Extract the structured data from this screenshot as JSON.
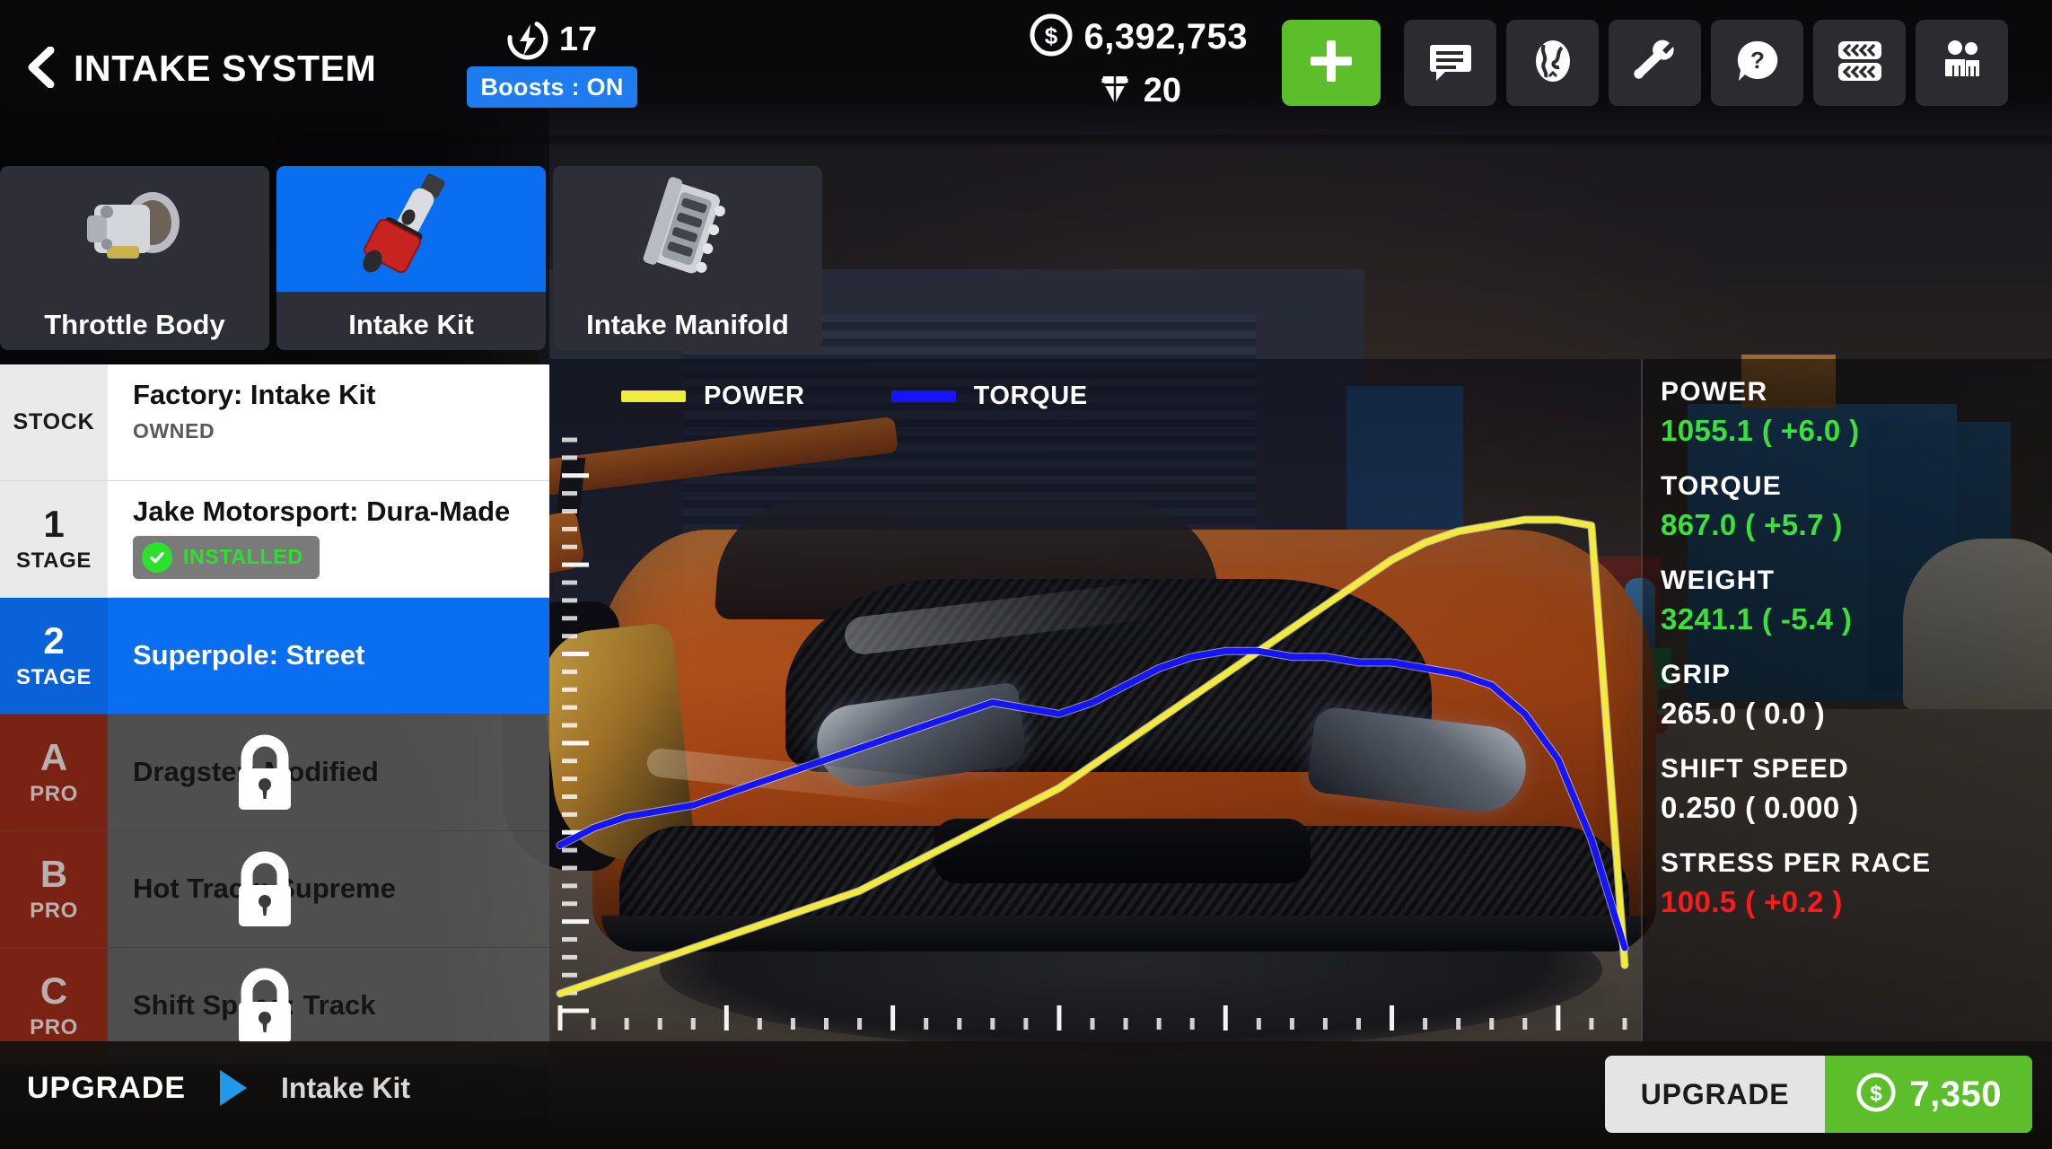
{
  "header": {
    "back_icon": "chevron-left-icon",
    "title": "INTAKE SYSTEM",
    "boost_icon": "boost-bolt-icon",
    "boost_count": "17",
    "boosts_toggle_label": "Boosts : ON",
    "cash_icon": "coin-dollar-icon",
    "cash": "6,392,753",
    "gem_icon": "gem-icon",
    "gems": "20",
    "add_button_icon": "plus-icon",
    "icon_buttons": [
      {
        "name": "chat-icon",
        "label": "Chat"
      },
      {
        "name": "globe-icon",
        "label": "World"
      },
      {
        "name": "wrench-icon",
        "label": "Tune"
      },
      {
        "name": "help-icon",
        "label": "Help"
      },
      {
        "name": "tires-icon",
        "label": "Tires"
      },
      {
        "name": "crew-icon",
        "label": "Crew"
      }
    ]
  },
  "tabs": [
    {
      "label": "Throttle Body",
      "icon": "throttle-body-icon",
      "selected": false
    },
    {
      "label": "Intake Kit",
      "icon": "intake-kit-icon",
      "selected": true
    },
    {
      "label": "Intake Manifold",
      "icon": "intake-manifold-icon",
      "selected": false
    }
  ],
  "parts": [
    {
      "badge_big": "",
      "badge_small": "STOCK",
      "name": "Factory: Intake Kit",
      "sub": "OWNED",
      "state": "owned",
      "locked": false
    },
    {
      "badge_big": "1",
      "badge_small": "STAGE",
      "name": "Jake Motorsport: Dura-Made",
      "sub": "INSTALLED",
      "state": "installed",
      "locked": false
    },
    {
      "badge_big": "2",
      "badge_small": "STAGE",
      "name": "Superpole: Street",
      "sub": "",
      "state": "selected",
      "locked": false
    },
    {
      "badge_big": "A",
      "badge_small": "PRO",
      "name": "Dragster: Modified",
      "sub": "",
      "state": "locked",
      "locked": true
    },
    {
      "badge_big": "B",
      "badge_small": "PRO",
      "name": "Hot Track: Supreme",
      "sub": "",
      "state": "locked",
      "locked": true
    },
    {
      "badge_big": "C",
      "badge_small": "PRO",
      "name": "Shift Speed: Track",
      "sub": "",
      "state": "locked",
      "locked": true
    }
  ],
  "stats": [
    {
      "label": "POWER",
      "value": "1055.1 ( +6.0 )",
      "tone": "green"
    },
    {
      "label": "TORQUE",
      "value": "867.0 ( +5.7 )",
      "tone": "green"
    },
    {
      "label": "WEIGHT",
      "value": "3241.1 ( -5.4 )",
      "tone": "green"
    },
    {
      "label": "GRIP",
      "value": "265.0 ( 0.0 )",
      "tone": "white"
    },
    {
      "label": "SHIFT SPEED",
      "value": "0.250 ( 0.000 )",
      "tone": "white"
    },
    {
      "label": "STRESS PER RACE",
      "value": "100.5 ( +0.2 )",
      "tone": "red"
    }
  ],
  "footer": {
    "upgrade_label": "UPGRADE",
    "arrow_icon": "play-triangle-icon",
    "subject": "Intake Kit",
    "button_label": "UPGRADE",
    "price_icon": "coin-dollar-icon",
    "price": "7,350"
  },
  "colors": {
    "accent_blue": "#0a6ef0",
    "green": "#5cbe2b",
    "stat_green": "#3ce03c",
    "stat_red": "#ff1a1a",
    "power_yellow": "#f2ea3c",
    "torque_blue": "#1414ff",
    "pro_red": "#7a2213"
  },
  "chart_data": {
    "type": "line",
    "title": "",
    "xlabel": "",
    "ylabel": "",
    "grid": false,
    "legend_position": "top-left",
    "x": [
      0,
      1,
      2,
      3,
      4,
      5,
      6,
      7,
      8,
      9,
      10,
      11,
      12,
      13,
      14,
      15,
      16,
      17,
      18,
      19,
      20,
      21,
      22,
      23,
      24,
      25,
      26,
      27,
      28,
      29,
      30,
      31,
      32
    ],
    "xlim": [
      0,
      32
    ],
    "ylim": [
      0,
      100
    ],
    "x_ticks_major_every": 5,
    "y_ticks_major_every": 5,
    "series": [
      {
        "name": "POWER",
        "color": "#f2ea3c",
        "values": [
          3,
          5,
          7,
          9,
          11,
          13,
          15,
          17,
          19,
          21,
          24,
          27,
          30,
          33,
          36,
          39,
          43,
          47,
          51,
          55,
          59,
          63,
          67,
          71,
          75,
          79,
          82,
          84,
          85,
          86,
          86,
          85,
          8
        ]
      },
      {
        "name": "TORQUE",
        "color": "#1414ff",
        "values": [
          29,
          32,
          34,
          35,
          36,
          38,
          40,
          42,
          44,
          46,
          48,
          50,
          52,
          54,
          53,
          52,
          54,
          57,
          60,
          62,
          63,
          63,
          62,
          62,
          61,
          61,
          60,
          59,
          57,
          52,
          44,
          30,
          11
        ]
      }
    ]
  }
}
